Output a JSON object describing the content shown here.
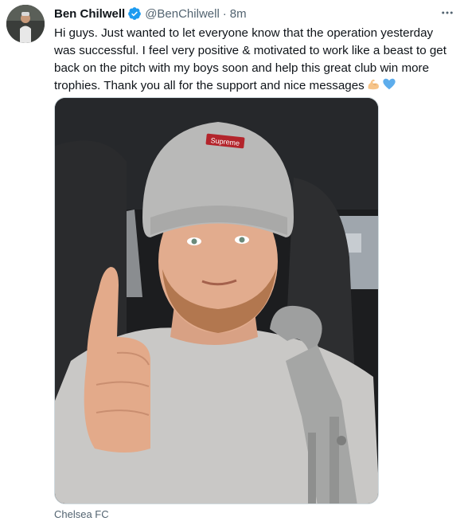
{
  "tweet": {
    "author_name": "Ben Chilwell",
    "handle": "@BenChilwell",
    "separator": "·",
    "timestamp": "8m",
    "verified": true,
    "more_icon": "more-horizontal-icon",
    "text": "Hi guys. Just wanted to let everyone know that the operation yesterday was successful. I feel very positive & motivated to work like a beast to get back on the pitch with my boys soon and help this great club win more trophies. Thank you all for the support and nice messages",
    "emojis": [
      "flexed-biceps-emoji",
      "blue-heart-emoji"
    ],
    "media": {
      "beanie_label": "Supreme"
    },
    "media_caption": "Chelsea FC"
  },
  "colors": {
    "text_primary": "#0f1419",
    "text_secondary": "#536471",
    "verified_blue": "#1d9bf0",
    "border": "#cfd9de"
  }
}
